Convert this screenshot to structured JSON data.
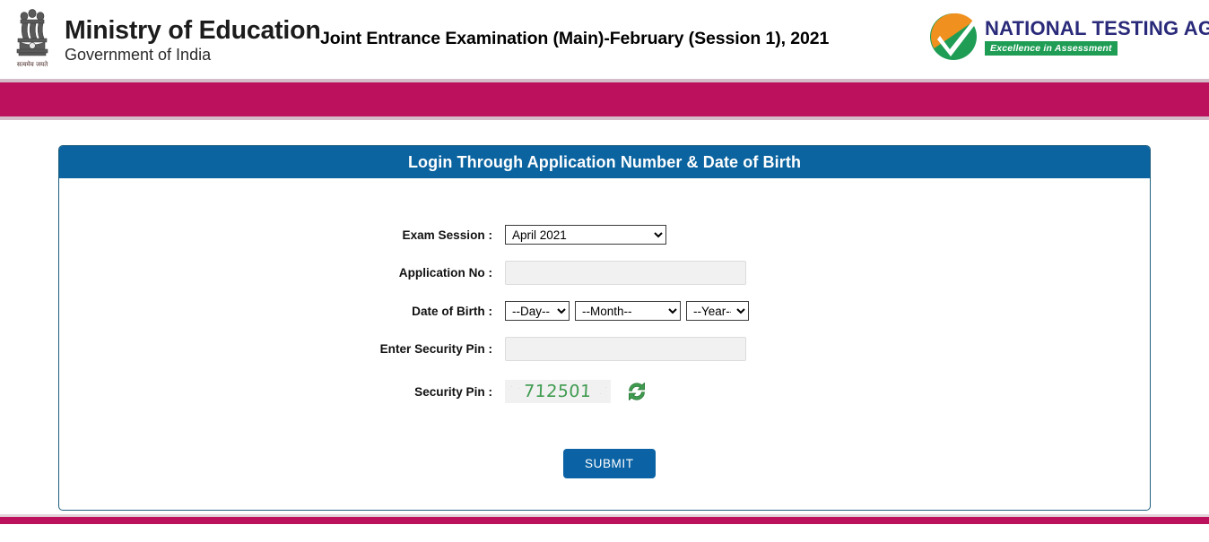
{
  "header": {
    "ministry_title": "Ministry of Education",
    "ministry_subtitle": "Government of India",
    "emblem_motto": "सत्यमेव जयते",
    "exam_title": "Joint Entrance Examination (Main)-February (Session 1), 2021",
    "nta_name": "NATIONAL TESTING AGENCY",
    "nta_tagline": "Excellence in Assessment",
    "icons": {
      "emblem": "ashoka-emblem-icon",
      "nta_mark": "nta-checkmark-logo-icon"
    }
  },
  "colors": {
    "crimson_bar": "#bc115c",
    "crimson_bar_edge": "#d5bcc9",
    "panel_header_blue": "#0b639f",
    "panel_border": "#1f5f7e",
    "submit_blue": "#0b63a5",
    "captcha_green": "#3f9b4f",
    "nta_navy": "#2a2a7a",
    "nta_green": "#1f9d55"
  },
  "panel": {
    "title": "Login Through Application Number & Date of Birth"
  },
  "form": {
    "exam_session": {
      "label": "Exam Session :",
      "value": "April 2021",
      "options": [
        "April 2021"
      ]
    },
    "application_no": {
      "label": "Application No :",
      "value": "",
      "placeholder": ""
    },
    "date_of_birth": {
      "label": "Date of Birth :",
      "day": {
        "value": "--Day--",
        "options": [
          "--Day--"
        ]
      },
      "month": {
        "value": "--Month--",
        "options": [
          "--Month--"
        ]
      },
      "year": {
        "value": "--Year--",
        "options": [
          "--Year--"
        ]
      }
    },
    "enter_security_pin": {
      "label": "Enter Security Pin :",
      "value": "",
      "placeholder": ""
    },
    "security_pin": {
      "label": "Security Pin :",
      "captcha_value": "712501",
      "refresh_icon": "refresh-captcha-icon"
    },
    "submit": {
      "label": "SUBMIT"
    }
  }
}
